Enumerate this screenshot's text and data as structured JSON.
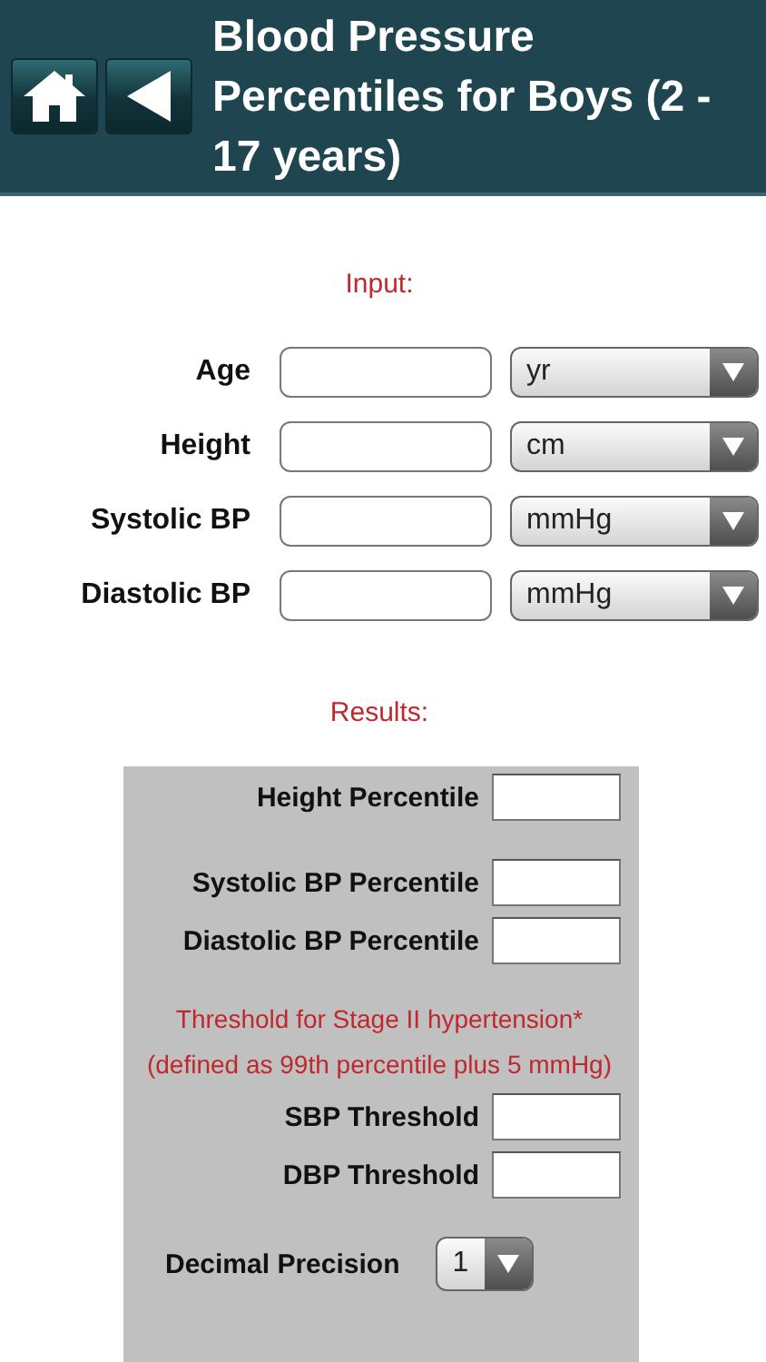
{
  "header": {
    "title": "Blood Pressure Percentiles for Boys (2 - 17 years)"
  },
  "input": {
    "heading": "Input:",
    "rows": [
      {
        "label": "Age",
        "unit": "yr"
      },
      {
        "label": "Height",
        "unit": "cm"
      },
      {
        "label": "Systolic BP",
        "unit": "mmHg"
      },
      {
        "label": "Diastolic BP",
        "unit": "mmHg"
      }
    ]
  },
  "results": {
    "heading": "Results:",
    "groups": [
      {
        "rows": [
          {
            "label": "Height Percentile"
          }
        ]
      },
      {
        "rows": [
          {
            "label": "Systolic BP Percentile"
          },
          {
            "label": "Diastolic BP Percentile"
          }
        ]
      },
      {
        "note_lines": [
          "Threshold for Stage II hypertension*",
          "(defined as 99th percentile plus 5 mmHg)"
        ],
        "rows": [
          {
            "label": "SBP Threshold"
          },
          {
            "label": "DBP Threshold"
          }
        ]
      }
    ],
    "precision": {
      "label": "Decimal Precision",
      "value": "1"
    }
  }
}
